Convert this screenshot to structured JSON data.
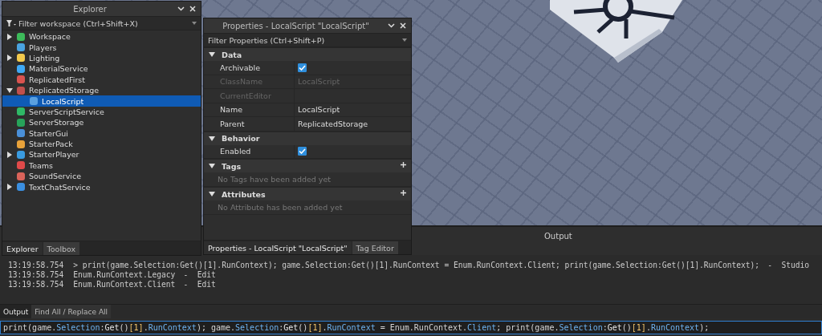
{
  "explorer": {
    "title": "Explorer",
    "filter": {
      "placeholder": "Filter workspace (Ctrl+Shift+X)"
    },
    "items": [
      {
        "name": "Workspace",
        "color": "#3dbb5a",
        "expanded": false,
        "selected": false
      },
      {
        "name": "Players",
        "color": "#4aa3e0",
        "selected": false
      },
      {
        "name": "Lighting",
        "color": "#f2c94c",
        "expanded": false,
        "selected": false
      },
      {
        "name": "MaterialService",
        "color": "#3fa9f5",
        "selected": false
      },
      {
        "name": "ReplicatedFirst",
        "color": "#d9534f",
        "selected": false
      },
      {
        "name": "ReplicatedStorage",
        "color": "#c0504d",
        "expanded": true,
        "selected": false,
        "children": [
          {
            "name": "LocalScript",
            "color": "#5aa0e0",
            "selected": true
          }
        ]
      },
      {
        "name": "ServerScriptService",
        "color": "#2fb866",
        "selected": false
      },
      {
        "name": "ServerStorage",
        "color": "#27a35a",
        "selected": false
      },
      {
        "name": "StarterGui",
        "color": "#4a90d9",
        "selected": false
      },
      {
        "name": "StarterPack",
        "color": "#e8a23a",
        "selected": false
      },
      {
        "name": "StarterPlayer",
        "color": "#3a9be0",
        "expanded": false,
        "selected": false
      },
      {
        "name": "Teams",
        "color": "#e04a4a",
        "selected": false
      },
      {
        "name": "SoundService",
        "color": "#d9635a",
        "selected": false
      },
      {
        "name": "TextChatService",
        "color": "#3b8fe0",
        "expanded": false,
        "selected": false
      }
    ],
    "tabs": [
      {
        "label": "Explorer",
        "selected": true
      },
      {
        "label": "Toolbox",
        "selected": false
      }
    ]
  },
  "properties": {
    "title": "Properties - LocalScript \"LocalScript\"",
    "filter": {
      "placeholder": "Filter Properties (Ctrl+Shift+P)"
    },
    "sections": [
      {
        "name": "Data",
        "expanded": true,
        "addable": false,
        "rows": [
          {
            "kind": "checkbox",
            "label": "Archivable",
            "checked": true,
            "disabled": false
          },
          {
            "kind": "text",
            "label": "ClassName",
            "value": "LocalScript",
            "disabled": true
          },
          {
            "kind": "text",
            "label": "CurrentEditor",
            "disabled": true
          },
          {
            "kind": "text",
            "label": "Name",
            "value": "LocalScript",
            "disabled": false
          },
          {
            "kind": "text",
            "label": "Parent",
            "value": "ReplicatedStorage",
            "disabled": false
          }
        ]
      },
      {
        "name": "Behavior",
        "expanded": true,
        "addable": false,
        "rows": [
          {
            "kind": "checkbox",
            "label": "Enabled",
            "checked": true,
            "disabled": false
          }
        ]
      },
      {
        "name": "Tags",
        "expanded": true,
        "addable": true,
        "empty_message": "No Tags have been added yet"
      },
      {
        "name": "Attributes",
        "expanded": true,
        "addable": true,
        "empty_message": "No Attribute has been added yet"
      }
    ],
    "tabs": [
      {
        "label": "Properties - LocalScript \"LocalScript\"",
        "selected": true
      },
      {
        "label": "Tag Editor",
        "selected": false
      }
    ]
  },
  "output": {
    "title": "Output",
    "lines": [
      {
        "time": "13:19:58.754",
        "message": "> print(game.Selection:Get()[1].RunContext); game.Selection:Get()[1].RunContext = Enum.RunContext.Client; print(game.Selection:Get()[1].RunContext);",
        "source": "-  Studio"
      },
      {
        "time": "13:19:58.754",
        "message": "Enum.RunContext.Legacy",
        "source": "-  Edit"
      },
      {
        "time": "13:19:58.754",
        "message": "Enum.RunContext.Client",
        "source": "-  Edit"
      }
    ],
    "tabs": [
      {
        "label": "Output",
        "selected": true
      },
      {
        "label": "Find All / Replace All",
        "selected": false
      }
    ],
    "command": [
      {
        "text": "print(game.",
        "kind": "plain"
      },
      {
        "text": "Selection",
        "kind": "member"
      },
      {
        "text": ":",
        "kind": "plain"
      },
      {
        "text": "Get",
        "kind": "method"
      },
      {
        "text": "()",
        "kind": "plain"
      },
      {
        "text": "[1]",
        "kind": "number"
      },
      {
        "text": ".",
        "kind": "plain"
      },
      {
        "text": "RunContext",
        "kind": "member"
      },
      {
        "text": "); game.",
        "kind": "plain"
      },
      {
        "text": "Selection",
        "kind": "member"
      },
      {
        "text": ":",
        "kind": "plain"
      },
      {
        "text": "Get",
        "kind": "method"
      },
      {
        "text": "()",
        "kind": "plain"
      },
      {
        "text": "[1]",
        "kind": "number"
      },
      {
        "text": ".",
        "kind": "plain"
      },
      {
        "text": "RunContext",
        "kind": "member"
      },
      {
        "text": " = Enum.RunContext.",
        "kind": "plain"
      },
      {
        "text": "Client",
        "kind": "member"
      },
      {
        "text": "; print(game.",
        "kind": "plain"
      },
      {
        "text": "Selection",
        "kind": "member"
      },
      {
        "text": ":",
        "kind": "plain"
      },
      {
        "text": "Get",
        "kind": "method"
      },
      {
        "text": "()",
        "kind": "plain"
      },
      {
        "text": "[1]",
        "kind": "number"
      },
      {
        "text": ".",
        "kind": "plain"
      },
      {
        "text": "RunContext",
        "kind": "member"
      },
      {
        "text": ");",
        "kind": "plain"
      }
    ]
  }
}
